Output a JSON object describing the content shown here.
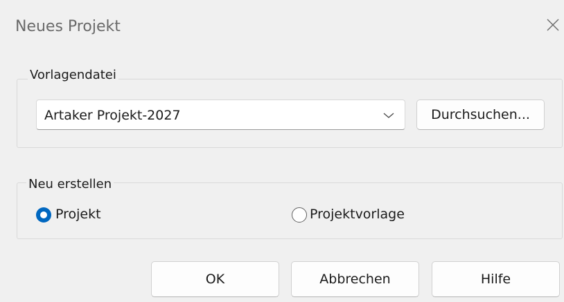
{
  "window": {
    "title": "Neues Projekt"
  },
  "template_group": {
    "legend": "Vorlagendatei",
    "selected_template": "Artaker Projekt-2027",
    "browse_label": "Durchsuchen..."
  },
  "create_group": {
    "legend": "Neu erstellen",
    "options": [
      {
        "label": "Projekt",
        "checked": true
      },
      {
        "label": "Projektvorlage",
        "checked": false
      }
    ]
  },
  "buttons": {
    "ok_label": "OK",
    "cancel_label": "Abbrechen",
    "help_label": "Hilfe"
  },
  "colors": {
    "accent": "#0067c0",
    "dialog_background": "#f0f0f0"
  }
}
